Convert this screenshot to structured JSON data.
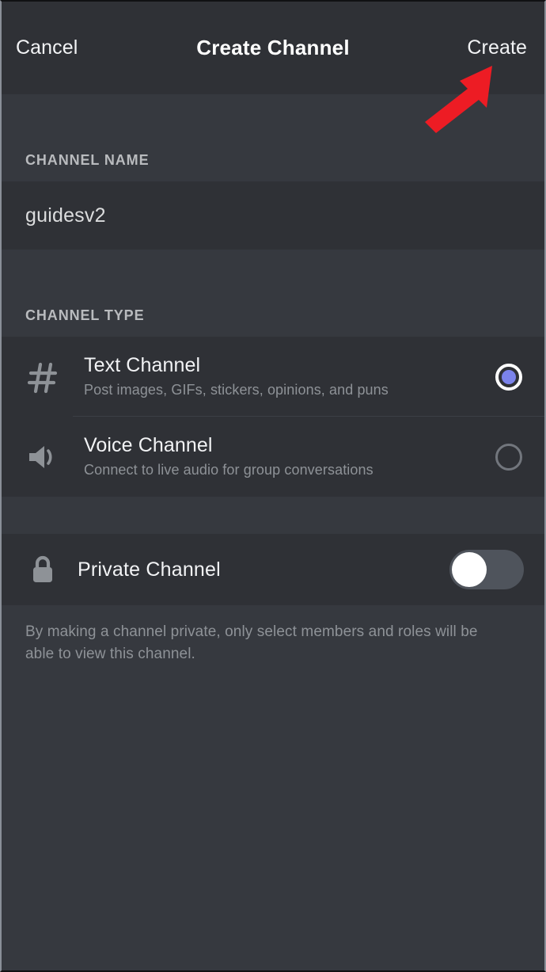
{
  "window": {
    "background_color": "#36393f",
    "panel_color": "#2f3136"
  },
  "navbar": {
    "cancel_label": "Cancel",
    "title": "Create Channel",
    "create_label": "Create"
  },
  "sections": {
    "channel_name": {
      "label": "CHANNEL NAME",
      "input_value": "guidesv2"
    },
    "channel_type": {
      "label": "CHANNEL TYPE",
      "options": [
        {
          "icon": "hash-icon",
          "title": "Text Channel",
          "description": "Post images, GIFs, stickers, opinions, and puns",
          "selected": true
        },
        {
          "icon": "speaker-icon",
          "title": "Voice Channel",
          "description": "Connect to live audio for group conversations",
          "selected": false
        }
      ],
      "selected_accent_color": "#7b83eb"
    },
    "private_channel": {
      "icon": "lock-icon",
      "label": "Private Channel",
      "toggle_on": false,
      "description": "By making a channel private, only select members and roles will be able to view this channel."
    }
  },
  "annotation": {
    "type": "arrow",
    "color": "#ed1c24",
    "points_to": "Create",
    "direction": "up-right"
  }
}
